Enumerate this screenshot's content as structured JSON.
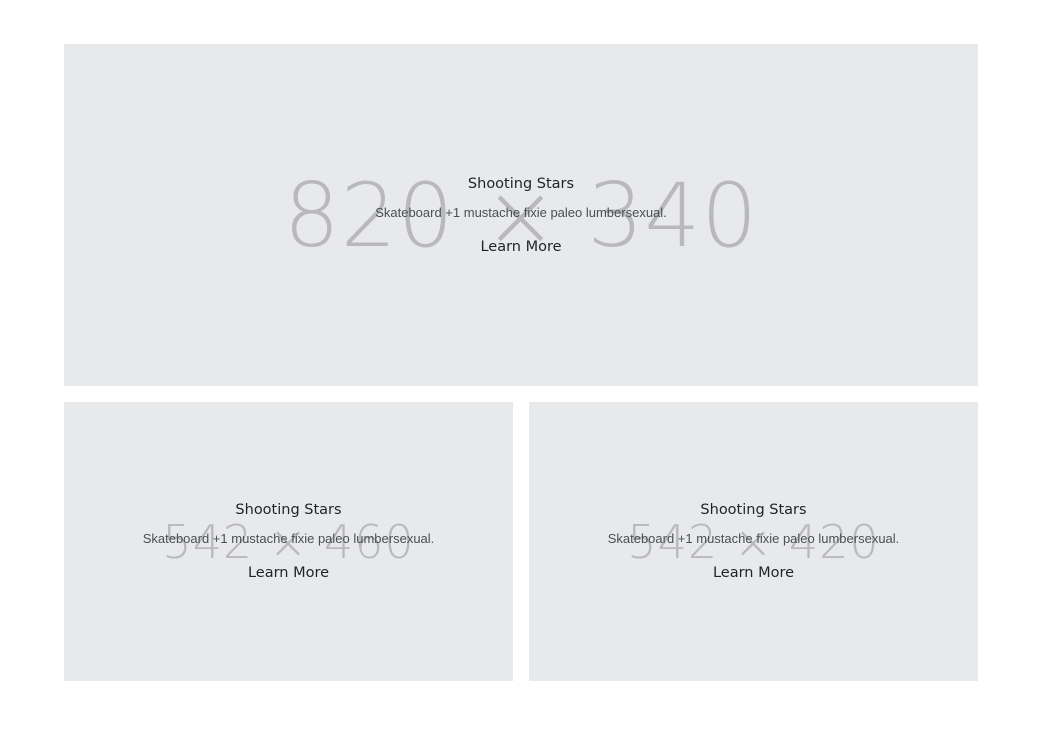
{
  "tiles": [
    {
      "placeholder_text": "820 × 340",
      "title": "Shooting Stars",
      "description": "Skateboard +1 mustache fixie paleo lumbersexual.",
      "link_label": "Learn More"
    },
    {
      "placeholder_text": "542 × 460",
      "title": "Shooting Stars",
      "description": "Skateboard +1 mustache fixie paleo lumbersexual.",
      "link_label": "Learn More"
    },
    {
      "placeholder_text": "542 × 420",
      "title": "Shooting Stars",
      "description": "Skateboard +1 mustache fixie paleo lumbersexual.",
      "link_label": "Learn More"
    }
  ],
  "colors": {
    "tile_background": "#e8e9eb",
    "placeholder_text": "#b9b9bb",
    "title_text": "#1f2329",
    "description_text": "#4a4e55"
  }
}
